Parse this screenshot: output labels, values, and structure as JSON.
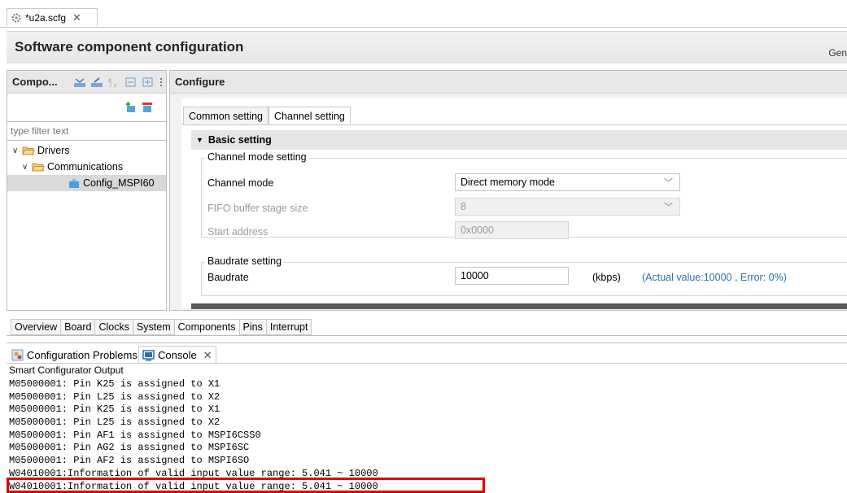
{
  "editor_tab": {
    "title": "*u2a.scfg",
    "close": "✕",
    "icon": "gear-file-icon"
  },
  "banner": {
    "title": "Software component configuration",
    "gen_text": "Gen"
  },
  "components_panel": {
    "title": "Compo...",
    "toolbar_icons": [
      "collapse-all-icon",
      "expand-icon",
      "sort-az-icon",
      "collapse-icon",
      "expand-all-icon",
      "more-icon"
    ],
    "add_icon": "add-component-icon",
    "remove_icon": "remove-component-icon",
    "filter_placeholder": "type filter text",
    "tree": [
      {
        "label": "Drivers",
        "level": 0,
        "expanded": true
      },
      {
        "label": "Communications",
        "level": 1,
        "expanded": true
      },
      {
        "label": "Config_MSPI60",
        "level": 2,
        "selected": true
      }
    ]
  },
  "configure": {
    "title": "Configure",
    "tabs": [
      {
        "label": "Common setting",
        "active": false
      },
      {
        "label": "Channel setting",
        "active": true
      }
    ],
    "basic_setting": "Basic setting",
    "channel_mode_group": {
      "legend": "Channel mode setting",
      "channel_mode_label": "Channel mode",
      "channel_mode_value": "Direct memory mode",
      "fifo_label": "FIFO buffer stage size",
      "fifo_value": "8",
      "start_address_label": "Start address",
      "start_address_value": "0x0000"
    },
    "baudrate_group": {
      "legend": "Baudrate setting",
      "baudrate_label": "Baudrate",
      "baudrate_value": "10000",
      "unit": "(kbps)",
      "actual": "(Actual value:10000 , Error: 0%)"
    }
  },
  "perspective_tabs": [
    {
      "label": "Overview",
      "active": false
    },
    {
      "label": "Board",
      "active": false
    },
    {
      "label": "Clocks",
      "active": false
    },
    {
      "label": "System",
      "active": false
    },
    {
      "label": "Components",
      "active": true
    },
    {
      "label": "Pins",
      "active": false
    },
    {
      "label": "Interrupt",
      "active": false
    }
  ],
  "console": {
    "problems_tab": "Configuration Problems",
    "console_tab": "Console",
    "close": "✕",
    "output_title": "Smart Configurator Output",
    "lines": [
      "M05000001: Pin K25 is assigned to X1",
      "M05000001: Pin L25 is assigned to X2",
      "M05000001: Pin K25 is assigned to X1",
      "M05000001: Pin L25 is assigned to X2",
      "M05000001: Pin AF1 is assigned to MSPI6CSS0",
      "M05000001: Pin AG2 is assigned to MSPI6SC",
      "M05000001: Pin AF2 is assigned to MSPI6SO",
      "W04010001:Information of valid input value range: 5.041 ~ 10000",
      "W04010001:Information of valid input value range: 5.041 ~ 10000"
    ]
  },
  "colors": {
    "highlight": "#e00000",
    "link_blue": "#2a6fb0",
    "folder_orange": "#e8a33d"
  }
}
